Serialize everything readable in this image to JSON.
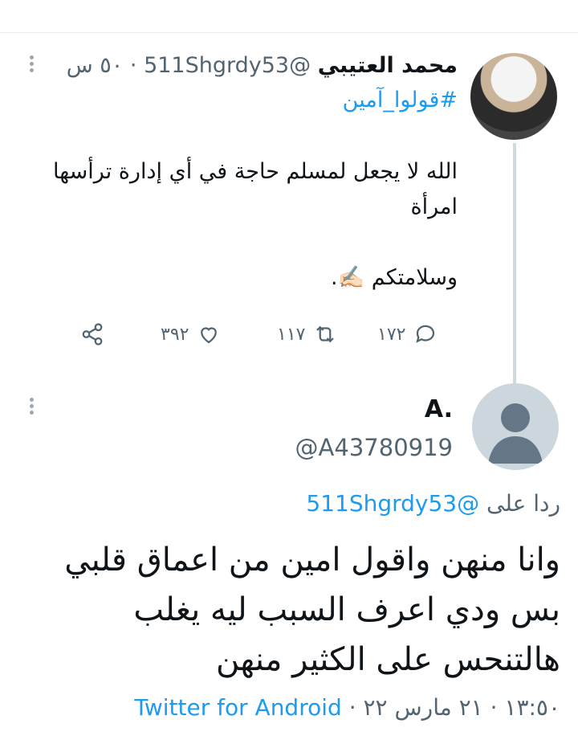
{
  "tweet1": {
    "name": "محمد العتيبي",
    "handle": "@511Shgrdy53",
    "separator": "·",
    "time": "٥٠ س",
    "hashtag": "#قولوا_آمين",
    "text": "الله لا يجعل لمسلم حاجة في أي إدارة ترأسها امرأة\n\nوسلامتكم ✍🏻.",
    "replies": "١٧٢",
    "retweets": "١١٧",
    "likes": "٣٩٢"
  },
  "tweet2": {
    "name": "A.",
    "handle": "@A43780919",
    "replying_prefix": "ردا على",
    "replying_mention": "@511Shgrdy53",
    "text": "وانا منهن  واقول امين من اعماق قلبي\nبس ودي اعرف السبب ليه يغلب\nهالتنحس على الكثير منهن",
    "timestamp": "١٣:٥٠ · ٢١ مارس ٢٢",
    "separator": "·",
    "source": "Twitter for Android"
  },
  "colors": {
    "accent": "#1d9bf0",
    "muted": "#536471",
    "thread_line": "#cfd9de"
  },
  "icons": [
    "more-icon",
    "reply-icon",
    "retweet-icon",
    "like-icon",
    "share-icon",
    "default-avatar-icon"
  ]
}
